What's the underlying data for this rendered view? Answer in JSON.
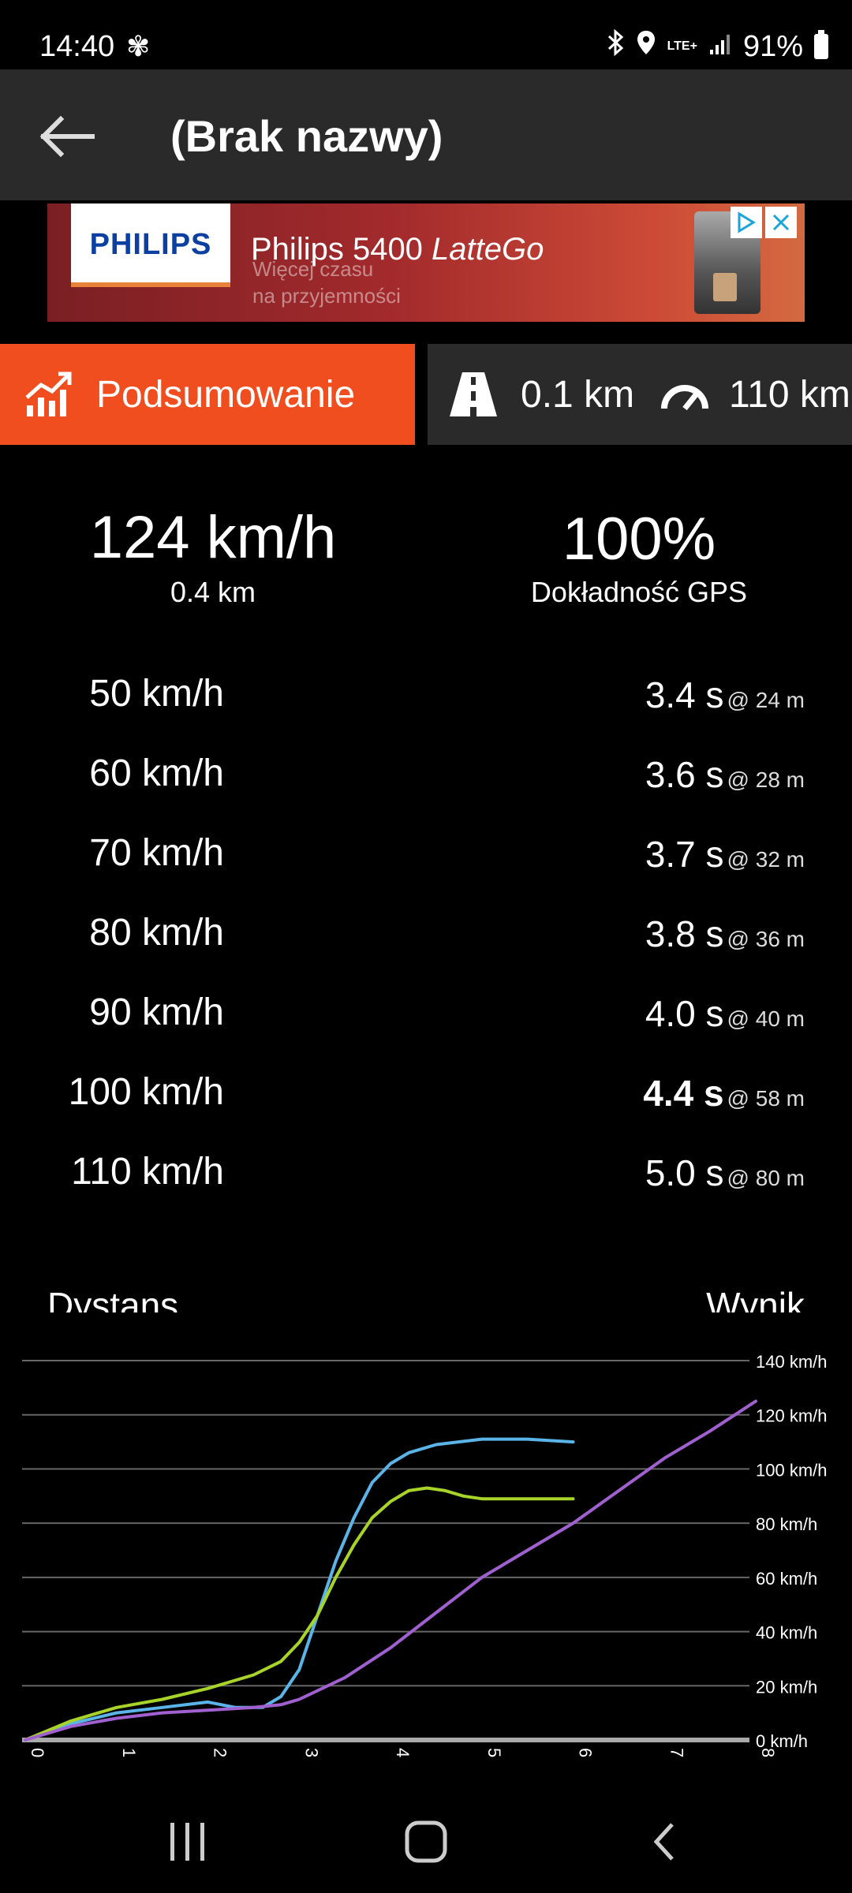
{
  "status_bar": {
    "time": "14:40",
    "network": "LTE+",
    "battery": "91%"
  },
  "app_bar": {
    "title": "(Brak nazwy)"
  },
  "ad": {
    "brand": "PHILIPS",
    "headline_prefix": "Philips 5400 ",
    "headline_product": "LatteGo",
    "sub_line1": "Więcej czasu",
    "sub_line2": "na przyjemności"
  },
  "tabs": {
    "summary_label": "Podsumowanie",
    "run_distance": "0.1 km",
    "run_speed": "110 km"
  },
  "summary": {
    "top_speed": "124 km/h",
    "top_distance": "0.4 km",
    "gps_accuracy": "100%",
    "gps_label": "Dokładność GPS"
  },
  "splits": [
    {
      "speed": "50 km/h",
      "time": "3.4 s",
      "dist": "@ 24 m",
      "bold": false
    },
    {
      "speed": "60 km/h",
      "time": "3.6 s",
      "dist": "@ 28 m",
      "bold": false
    },
    {
      "speed": "70 km/h",
      "time": "3.7 s",
      "dist": "@ 32 m",
      "bold": false
    },
    {
      "speed": "80 km/h",
      "time": "3.8 s",
      "dist": "@ 36 m",
      "bold": false
    },
    {
      "speed": "90 km/h",
      "time": "4.0 s",
      "dist": "@ 40 m",
      "bold": false
    },
    {
      "speed": "100 km/h",
      "time": "4.4 s",
      "dist": "@ 58 m",
      "bold": true
    },
    {
      "speed": "110 km/h",
      "time": "5.0 s",
      "dist": "@ 80 m",
      "bold": false
    }
  ],
  "section_labels": {
    "distance": "Dystans",
    "result": "Wynik"
  },
  "colors": {
    "accent": "#f04e1e",
    "blue": "#5ab4e8",
    "green": "#a8d42a",
    "purple": "#a060d0"
  },
  "chart_data": {
    "type": "line",
    "x_ticks": [
      "0",
      "1",
      "2",
      "3",
      "4",
      "5",
      "6",
      "7",
      "8"
    ],
    "y_ticks": [
      "0 km/h",
      "20 km/h",
      "40 km/h",
      "60 km/h",
      "80 km/h",
      "100 km/h",
      "120 km/h",
      "140 km/h"
    ],
    "xlim": [
      0,
      8
    ],
    "ylim": [
      0,
      140
    ],
    "grid": true,
    "series": [
      {
        "color": "#5ab4e8",
        "x": [
          0,
          0.5,
          1,
          1.5,
          2,
          2.3,
          2.6,
          2.8,
          3,
          3.2,
          3.4,
          3.6,
          3.8,
          4,
          4.2,
          4.5,
          5,
          5.5,
          6
        ],
        "y": [
          0,
          6,
          10,
          12,
          14,
          12,
          12,
          16,
          26,
          46,
          66,
          82,
          95,
          102,
          106,
          109,
          111,
          111,
          110
        ]
      },
      {
        "color": "#a8d42a",
        "x": [
          0,
          0.5,
          1,
          1.5,
          2,
          2.5,
          2.8,
          3,
          3.2,
          3.4,
          3.6,
          3.8,
          4,
          4.2,
          4.4,
          4.6,
          4.8,
          5,
          5.5,
          6
        ],
        "y": [
          0,
          7,
          12,
          15,
          19,
          24,
          29,
          36,
          46,
          60,
          72,
          82,
          88,
          92,
          93,
          92,
          90,
          89,
          89,
          89
        ]
      },
      {
        "color": "#a060d0",
        "x": [
          0,
          0.5,
          1,
          1.5,
          2,
          2.5,
          2.8,
          3,
          3.5,
          4,
          4.5,
          5,
          5.5,
          6,
          6.5,
          7,
          7.5,
          8
        ],
        "y": [
          0,
          5,
          8,
          10,
          11,
          12,
          13,
          15,
          23,
          34,
          47,
          60,
          70,
          80,
          92,
          104,
          114,
          125
        ]
      }
    ]
  }
}
